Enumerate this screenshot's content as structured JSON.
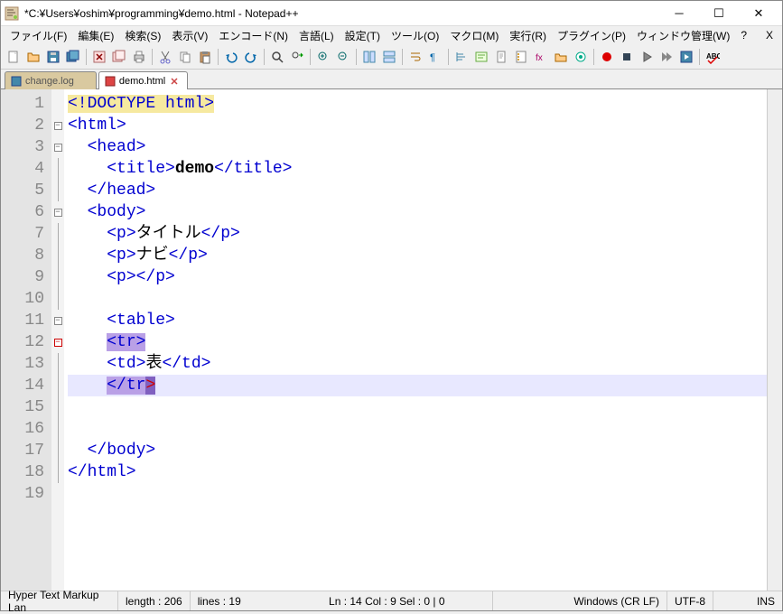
{
  "window": {
    "title": "*C:¥Users¥oshim¥programming¥demo.html - Notepad++"
  },
  "menu": {
    "items": [
      "ファイル(F)",
      "編集(E)",
      "検索(S)",
      "表示(V)",
      "エンコード(N)",
      "言語(L)",
      "設定(T)",
      "ツール(O)",
      "マクロ(M)",
      "実行(R)",
      "プラグイン(P)",
      "ウィンドウ管理(W)",
      "?"
    ],
    "close_x": "X"
  },
  "tabs": {
    "inactive": {
      "label": "change.log"
    },
    "active": {
      "label": "demo.html"
    }
  },
  "code": {
    "line_count": 19,
    "lines": [
      {
        "n": 1,
        "html": "<!DOCTYPE html>",
        "fold": ""
      },
      {
        "n": 2,
        "html": "<html>",
        "fold": "-"
      },
      {
        "n": 3,
        "html": "  <head>",
        "fold": "-"
      },
      {
        "n": 4,
        "html": "    <title>demo</title>",
        "fold": "|"
      },
      {
        "n": 5,
        "html": "  </head>",
        "fold": "|"
      },
      {
        "n": 6,
        "html": "  <body>",
        "fold": "-"
      },
      {
        "n": 7,
        "html": "    <p>タイトル</p>",
        "fold": "|"
      },
      {
        "n": 8,
        "html": "    <p>ナビ</p>",
        "fold": "|"
      },
      {
        "n": 9,
        "html": "    <p></p>",
        "fold": "|"
      },
      {
        "n": 10,
        "html": "",
        "fold": "|"
      },
      {
        "n": 11,
        "html": "    <table>",
        "fold": "-"
      },
      {
        "n": 12,
        "html": "    <tr>",
        "fold": "-r"
      },
      {
        "n": 13,
        "html": "    <td>表</td>",
        "fold": "|"
      },
      {
        "n": 14,
        "html": "    </tr>",
        "fold": "|",
        "current": true
      },
      {
        "n": 15,
        "html": "",
        "fold": "|"
      },
      {
        "n": 16,
        "html": "",
        "fold": "|"
      },
      {
        "n": 17,
        "html": "  </body>",
        "fold": "|"
      },
      {
        "n": 18,
        "html": "</html>",
        "fold": "|"
      },
      {
        "n": 19,
        "html": "",
        "fold": ""
      }
    ]
  },
  "status": {
    "lang": "Hyper Text Markup Lan",
    "length": "length : 206",
    "lines": "lines : 19",
    "pos": "Ln : 14   Col : 9   Sel : 0 | 0",
    "eol": "Windows (CR LF)",
    "enc": "UTF-8",
    "ins": "INS"
  }
}
